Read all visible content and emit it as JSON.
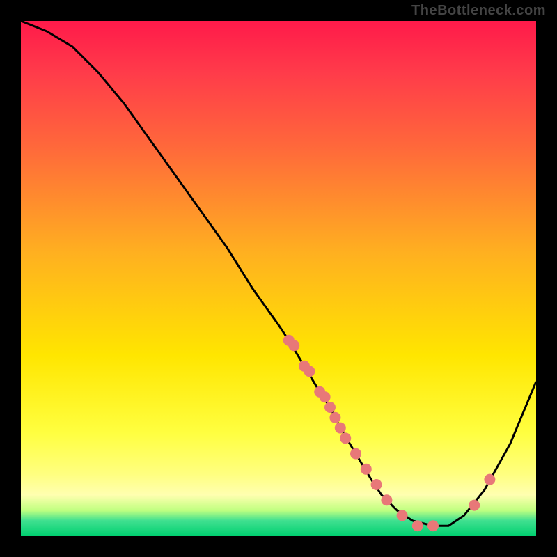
{
  "watermark": "TheBottleneck.com",
  "chart_data": {
    "type": "line",
    "title": "",
    "xlabel": "",
    "ylabel": "",
    "xlim": [
      0,
      100
    ],
    "ylim": [
      0,
      100
    ],
    "curve": {
      "x": [
        0,
        5,
        10,
        15,
        20,
        25,
        30,
        35,
        40,
        45,
        50,
        52,
        55,
        58,
        60,
        62,
        65,
        68,
        70,
        73,
        76,
        80,
        83,
        86,
        90,
        95,
        100
      ],
      "y": [
        100,
        98,
        95,
        90,
        84,
        77,
        70,
        63,
        56,
        48,
        41,
        38,
        33,
        28,
        25,
        21,
        16,
        11,
        8,
        5,
        3,
        2,
        2,
        4,
        9,
        18,
        30
      ]
    },
    "markers": {
      "x": [
        52,
        53,
        55,
        56,
        58,
        59,
        60,
        61,
        62,
        63,
        65,
        67,
        69,
        71,
        74,
        77,
        80,
        88,
        91
      ],
      "y": [
        38,
        37,
        33,
        32,
        28,
        27,
        25,
        23,
        21,
        19,
        16,
        13,
        10,
        7,
        4,
        2,
        2,
        6,
        11
      ],
      "color": "#e87878",
      "radius": 8
    },
    "curve_color": "#000000",
    "curve_width": 3
  }
}
